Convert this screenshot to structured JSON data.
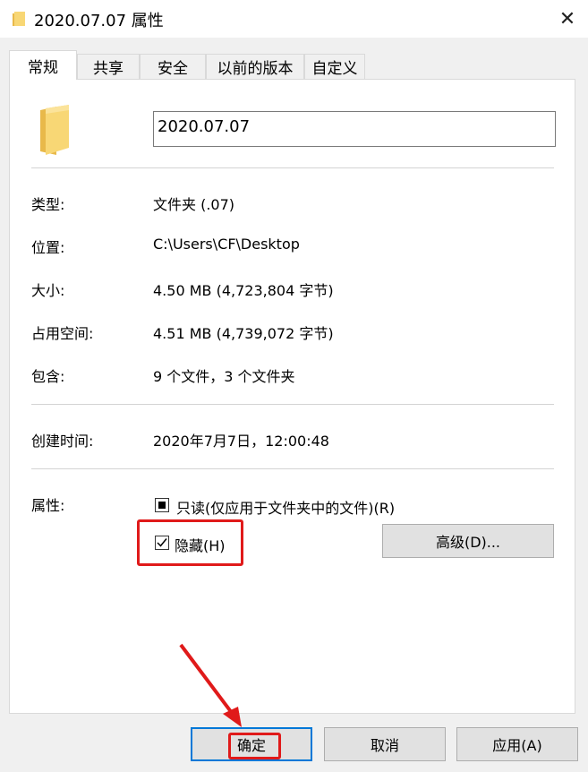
{
  "window": {
    "title": "2020.07.07 属性",
    "close_glyph": "✕"
  },
  "tabs": [
    {
      "label": "常规",
      "active": true
    },
    {
      "label": "共享"
    },
    {
      "label": "安全"
    },
    {
      "label": "以前的版本"
    },
    {
      "label": "自定义"
    }
  ],
  "general": {
    "folder_name": "2020.07.07",
    "rows": [
      {
        "label": "类型:",
        "value": "文件夹 (.07)"
      },
      {
        "label": "位置:",
        "value": "C:\\Users\\CF\\Desktop"
      },
      {
        "label": "大小:",
        "value": "4.50 MB (4,723,804 字节)"
      },
      {
        "label": "占用空间:",
        "value": "4.51 MB (4,739,072 字节)"
      },
      {
        "label": "包含:",
        "value": "9 个文件，3 个文件夹"
      }
    ],
    "created_label": "创建时间:",
    "created_value": "2020年7月7日，12:00:48",
    "attributes_label": "属性:",
    "readonly_label": "只读(仅应用于文件夹中的文件)(R)",
    "readonly_state": "indeterminate",
    "hidden_label": "隐藏(H)",
    "hidden_state": "checked",
    "advanced_button": "高级(D)..."
  },
  "buttons": {
    "ok": "确定",
    "cancel": "取消",
    "apply": "应用(A)"
  },
  "colors": {
    "folder": "#f8d775",
    "folder_dark": "#e8b94a",
    "highlight": "#e01a1a",
    "default_border": "#0078d7"
  }
}
